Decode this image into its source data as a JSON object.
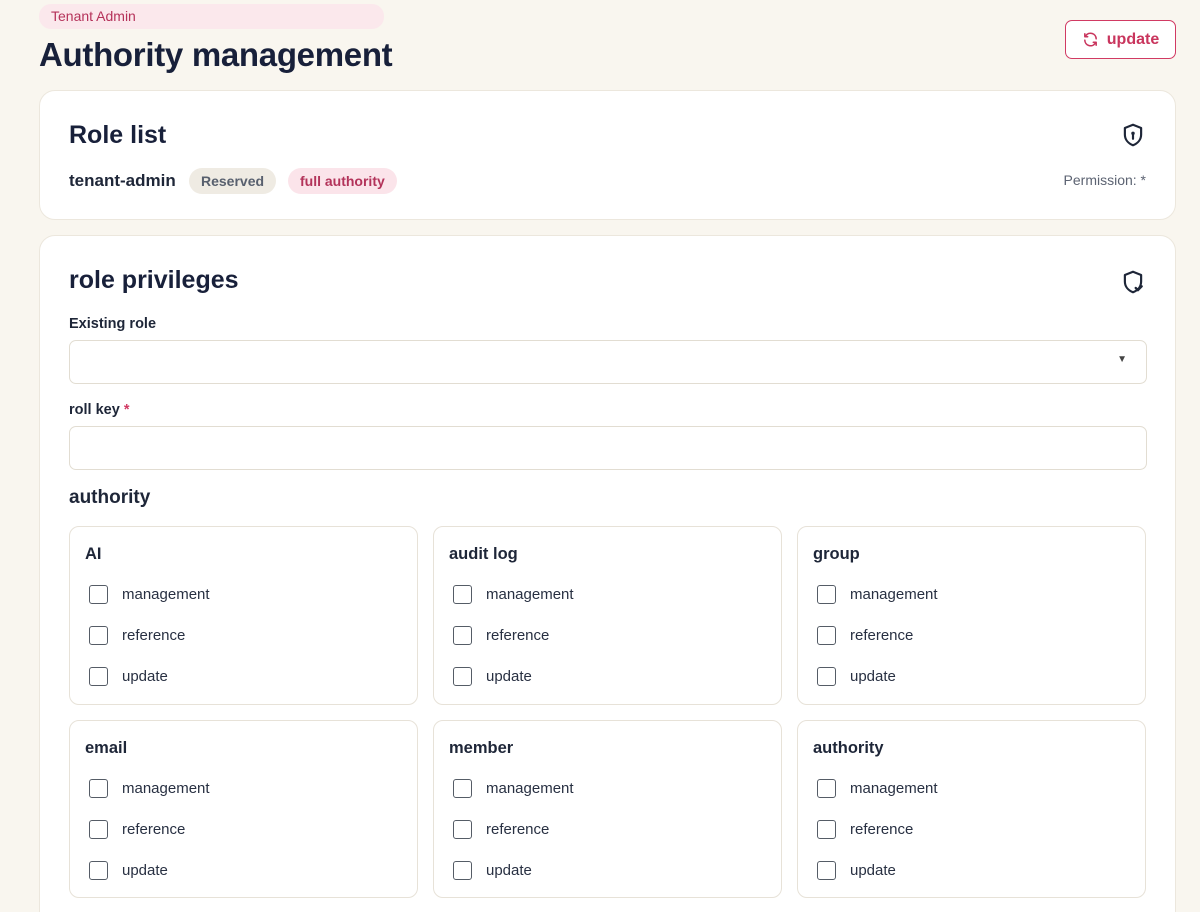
{
  "header": {
    "breadcrumb": "Tenant Admin",
    "title": "Authority management",
    "update_label": "update"
  },
  "role_list": {
    "title": "Role list",
    "role_name": "tenant-admin",
    "badges": [
      "Reserved",
      "full authority"
    ],
    "permission": "Permission: *",
    "icon": "shield-keyhole-icon"
  },
  "privileges": {
    "title": "role privileges",
    "icon": "shield-check-icon",
    "existing_role_label": "Existing role",
    "existing_role_value": "",
    "roll_key_label": "roll key",
    "roll_key_required": "*",
    "roll_key_value": "",
    "authority_label": "authority",
    "groups": [
      {
        "name": "AI",
        "options": [
          "management",
          "reference",
          "update"
        ]
      },
      {
        "name": "audit log",
        "options": [
          "management",
          "reference",
          "update"
        ]
      },
      {
        "name": "group",
        "options": [
          "management",
          "reference",
          "update"
        ]
      },
      {
        "name": "email",
        "options": [
          "management",
          "reference",
          "update"
        ]
      },
      {
        "name": "member",
        "options": [
          "management",
          "reference",
          "update"
        ]
      },
      {
        "name": "authority",
        "options": [
          "management",
          "reference",
          "update"
        ]
      }
    ]
  },
  "colors": {
    "accent": "#d13a63",
    "background": "#f9f6ef",
    "badge_pink": "#fbe4ea",
    "badge_neutral": "#efebe3"
  }
}
